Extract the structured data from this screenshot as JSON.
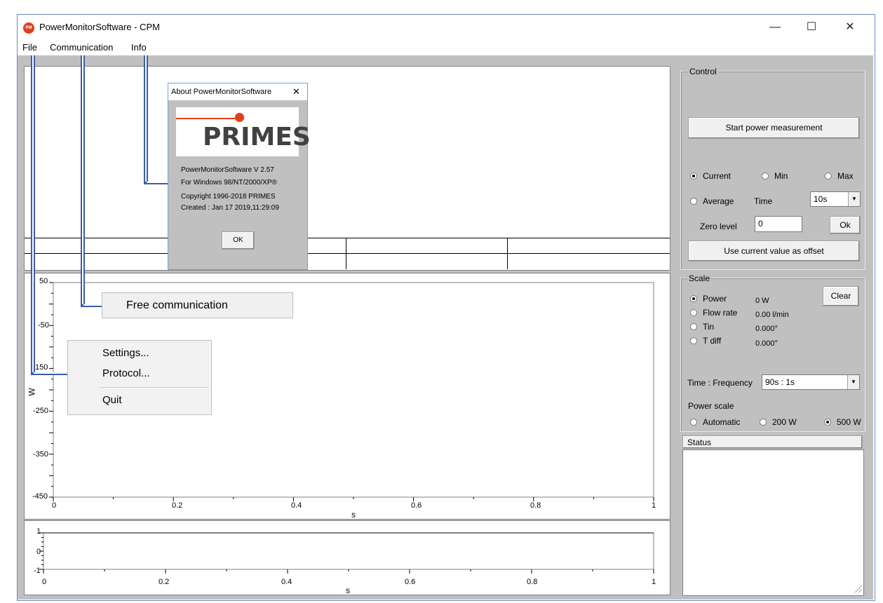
{
  "window": {
    "title": "PowerMonitorSoftware - CPM",
    "app_icon_text": "PM",
    "minimize": "—",
    "maximize": "☐",
    "close": "✕"
  },
  "menubar": {
    "items": [
      "File",
      "Communication",
      "Info"
    ]
  },
  "about_dialog": {
    "title": "About PowerMonitorSoftware",
    "close": "✕",
    "logo_text": "PRIMES",
    "lines": [
      "PowerMonitorSoftware V 2.57",
      "For Windows 98/NT/2000/XP®",
      "Copyright 1996-2018 PRIMES",
      "Created :  Jan 17 2019,11:29:09"
    ],
    "ok_label": "OK"
  },
  "communication_menu": {
    "items": [
      "Free communication"
    ]
  },
  "file_menu": {
    "items": [
      "Settings...",
      "Protocol...",
      "Quit"
    ]
  },
  "main_chart": {
    "ylabel": "W",
    "xlabel": "s",
    "yticks": [
      "50",
      "-50",
      "150",
      "-250",
      "-350",
      "-450"
    ],
    "xticks": [
      "0",
      "0.2",
      "0.4",
      "0.6",
      "0.8",
      "1"
    ]
  },
  "small_chart": {
    "xlabel": "s",
    "yticks": [
      "1",
      "0",
      "-1"
    ],
    "xticks": [
      "0",
      "0.2",
      "0.4",
      "0.6",
      "0.8",
      "1"
    ]
  },
  "control": {
    "label": "Control",
    "start_button": "Start power measurement",
    "radio_current": "Current",
    "radio_min": "Min",
    "radio_max": "Max",
    "radio_average": "Average",
    "time_label": "Time",
    "time_value": "10s",
    "zero_level_label": "Zero level",
    "zero_level_value": "0",
    "ok_label": "Ok",
    "offset_button": "Use current value as offset",
    "selected": "Current"
  },
  "scale": {
    "label": "Scale",
    "clear_button": "Clear",
    "rows": [
      {
        "name": "Power",
        "value": "0 W",
        "selected": true
      },
      {
        "name": "Flow rate",
        "value": "0.00 l/min",
        "selected": false
      },
      {
        "name": "Tin",
        "value": "0.000°",
        "selected": false
      },
      {
        "name": "T diff",
        "value": "0.000°",
        "selected": false
      }
    ],
    "time_frequency_label": "Time : Frequency",
    "time_frequency_value": "90s : 1s",
    "power_scale_label": "Power scale",
    "power_options": [
      "Automatic",
      "200 W",
      "500 W"
    ],
    "power_selected": "500 W"
  },
  "status": {
    "label": "Status"
  },
  "colors": {
    "client_bg": "#c0c0c0",
    "connector": "#3b5ea8",
    "logo_red": "#e2401c",
    "logo_text": "#3f4143"
  }
}
